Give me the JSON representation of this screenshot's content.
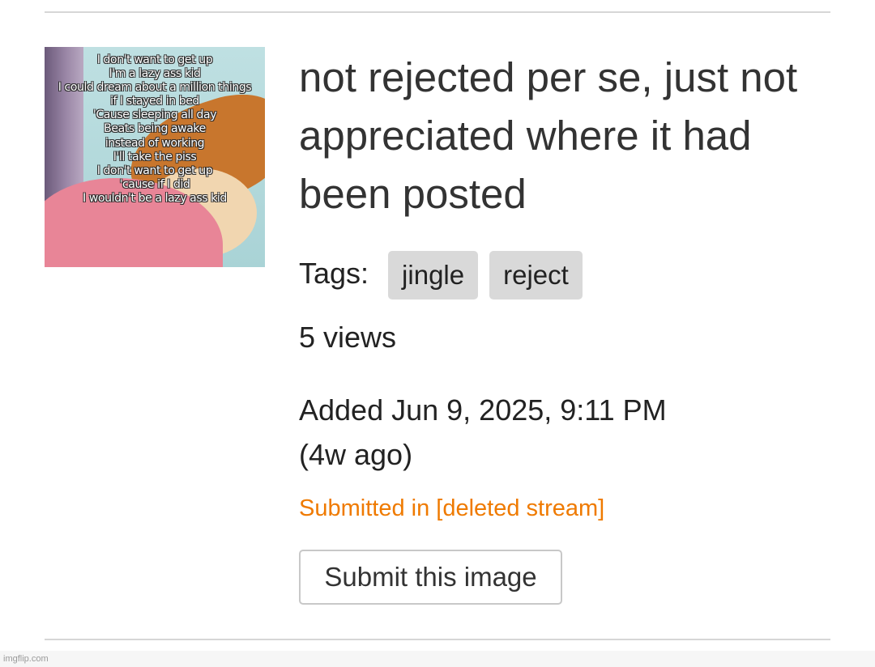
{
  "thumbnail": {
    "alt": "meme thumbnail",
    "lyrics": [
      "I don't want to get up",
      "I'm a lazy ass kid",
      "I could dream about a million things",
      "if I stayed in bed",
      "'Cause sleeping all day",
      "Beats being awake",
      "instead of working",
      "I'll take the piss",
      "I don't want to get up",
      "'cause if I did",
      "I wouldn't be a lazy ass kid"
    ]
  },
  "post": {
    "title": "not rejected per se, just not appreciated where it had been posted",
    "tags_label": "Tags:",
    "tags": [
      "jingle",
      "reject"
    ],
    "views": "5 views",
    "added_line": "Added Jun 9, 2025, 9:11 PM",
    "added_ago": "(4w ago)",
    "submitted_in": "Submitted in [deleted stream]",
    "submit_button": "Submit this image"
  },
  "footer": {
    "brand": "imgflip.com"
  },
  "colors": {
    "accent_link": "#ef7a00",
    "tag_bg": "#d9d9d9",
    "divider": "#d6d6d6"
  }
}
